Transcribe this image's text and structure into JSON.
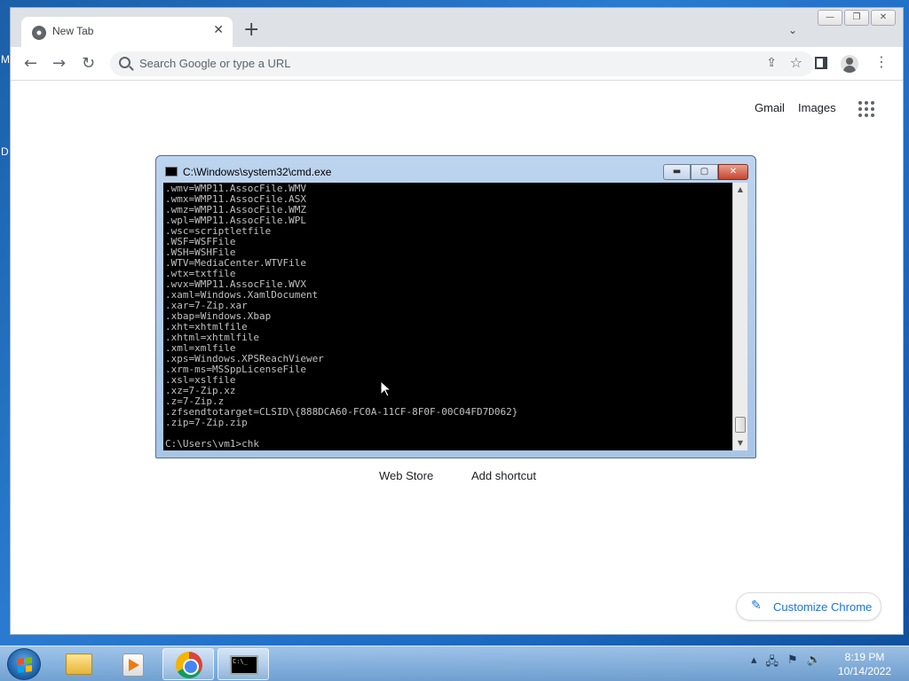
{
  "desktop": {
    "edge_letters": [
      "M",
      "D"
    ]
  },
  "browser": {
    "tab_title": "New Tab",
    "new_tab_label": "+",
    "omnibox_placeholder": "Search Google or type a URL",
    "top_links": {
      "gmail": "Gmail",
      "images": "Images"
    },
    "shortcuts": [
      "Web Store",
      "Add shortcut"
    ],
    "customize_label": "Customize Chrome"
  },
  "cmd": {
    "title": "C:\\Windows\\system32\\cmd.exe",
    "lines": [
      ".wmv=WMP11.AssocFile.WMV",
      ".wmx=WMP11.AssocFile.ASX",
      ".wmz=WMP11.AssocFile.WMZ",
      ".wpl=WMP11.AssocFile.WPL",
      ".wsc=scriptletfile",
      ".WSF=WSFFile",
      ".WSH=WSHFile",
      ".WTV=MediaCenter.WTVFile",
      ".wtx=txtfile",
      ".wvx=WMP11.AssocFile.WVX",
      ".xaml=Windows.XamlDocument",
      ".xar=7-Zip.xar",
      ".xbap=Windows.Xbap",
      ".xht=xhtmlfile",
      ".xhtml=xhtmlfile",
      ".xml=xmlfile",
      ".xps=Windows.XPSReachViewer",
      ".xrm-ms=MSSppLicenseFile",
      ".xsl=xslfile",
      ".xz=7-Zip.xz",
      ".z=7-Zip.z",
      ".zfsendtotarget=CLSID\\{888DCA60-FC0A-11CF-8F0F-00C04FD7D062}",
      ".zip=7-Zip.zip"
    ],
    "prompt": "C:\\Users\\vm1>chk"
  },
  "taskbar": {
    "time": "8:19 PM",
    "date": "10/14/2022",
    "cmd_icon_text": "C:\\_"
  },
  "colors": {
    "accent": "#1a73e8",
    "console_bg": "#000000",
    "console_fg": "#c0c0c0"
  }
}
